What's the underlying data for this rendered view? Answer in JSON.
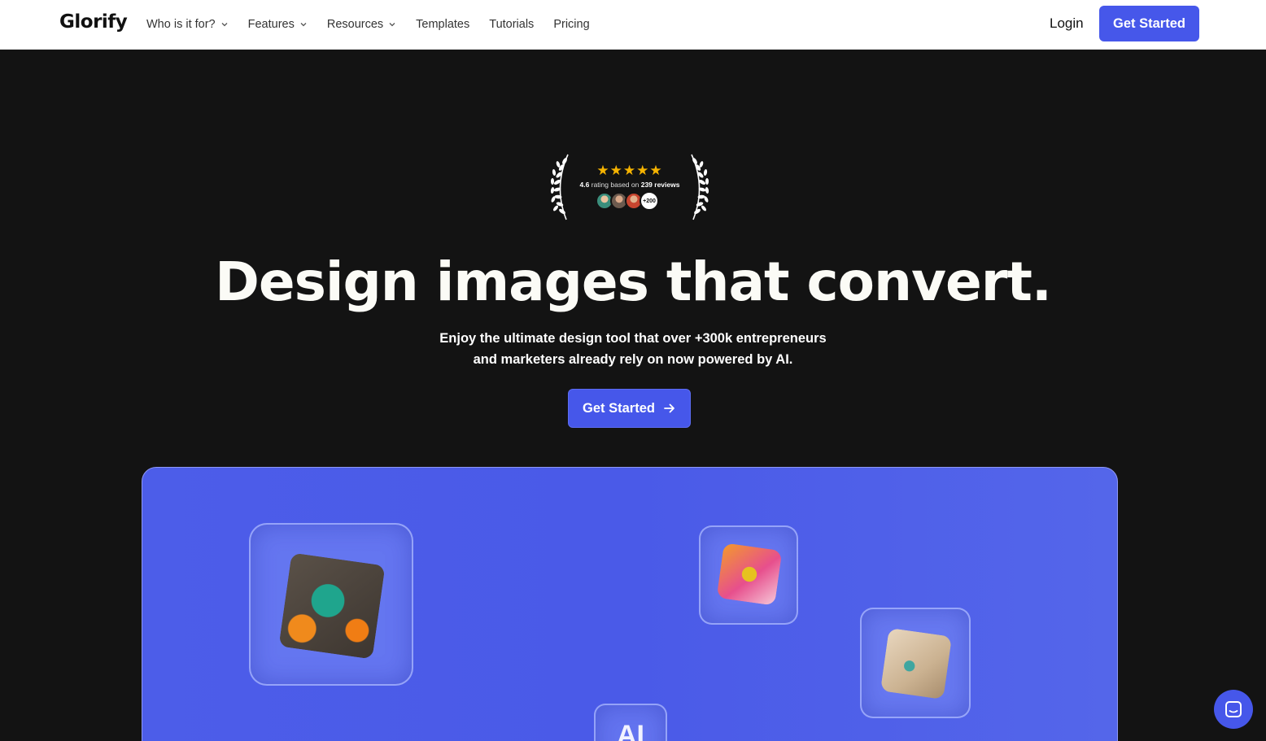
{
  "header": {
    "logo": "Glorify",
    "nav": [
      {
        "label": "Who is it for?",
        "has_dropdown": true
      },
      {
        "label": "Features",
        "has_dropdown": true
      },
      {
        "label": "Resources",
        "has_dropdown": true
      },
      {
        "label": "Templates",
        "has_dropdown": false
      },
      {
        "label": "Tutorials",
        "has_dropdown": false
      },
      {
        "label": "Pricing",
        "has_dropdown": false
      }
    ],
    "login": "Login",
    "cta": "Get Started"
  },
  "rating": {
    "stars": "★★★★★",
    "score": "4.6",
    "text_mid": "rating based on",
    "reviews": "239 reviews",
    "more_count": "+200"
  },
  "hero": {
    "title": "Design images that convert.",
    "subtitle_line1": "Enjoy the ultimate design tool that over +300k entrepreneurs",
    "subtitle_line2": "and marketers already rely on now powered by AI.",
    "cta": "Get Started"
  },
  "showcase": {
    "ai_label": "AI"
  },
  "colors": {
    "accent": "#4657ea",
    "background": "#131313",
    "star": "#f5b301"
  }
}
